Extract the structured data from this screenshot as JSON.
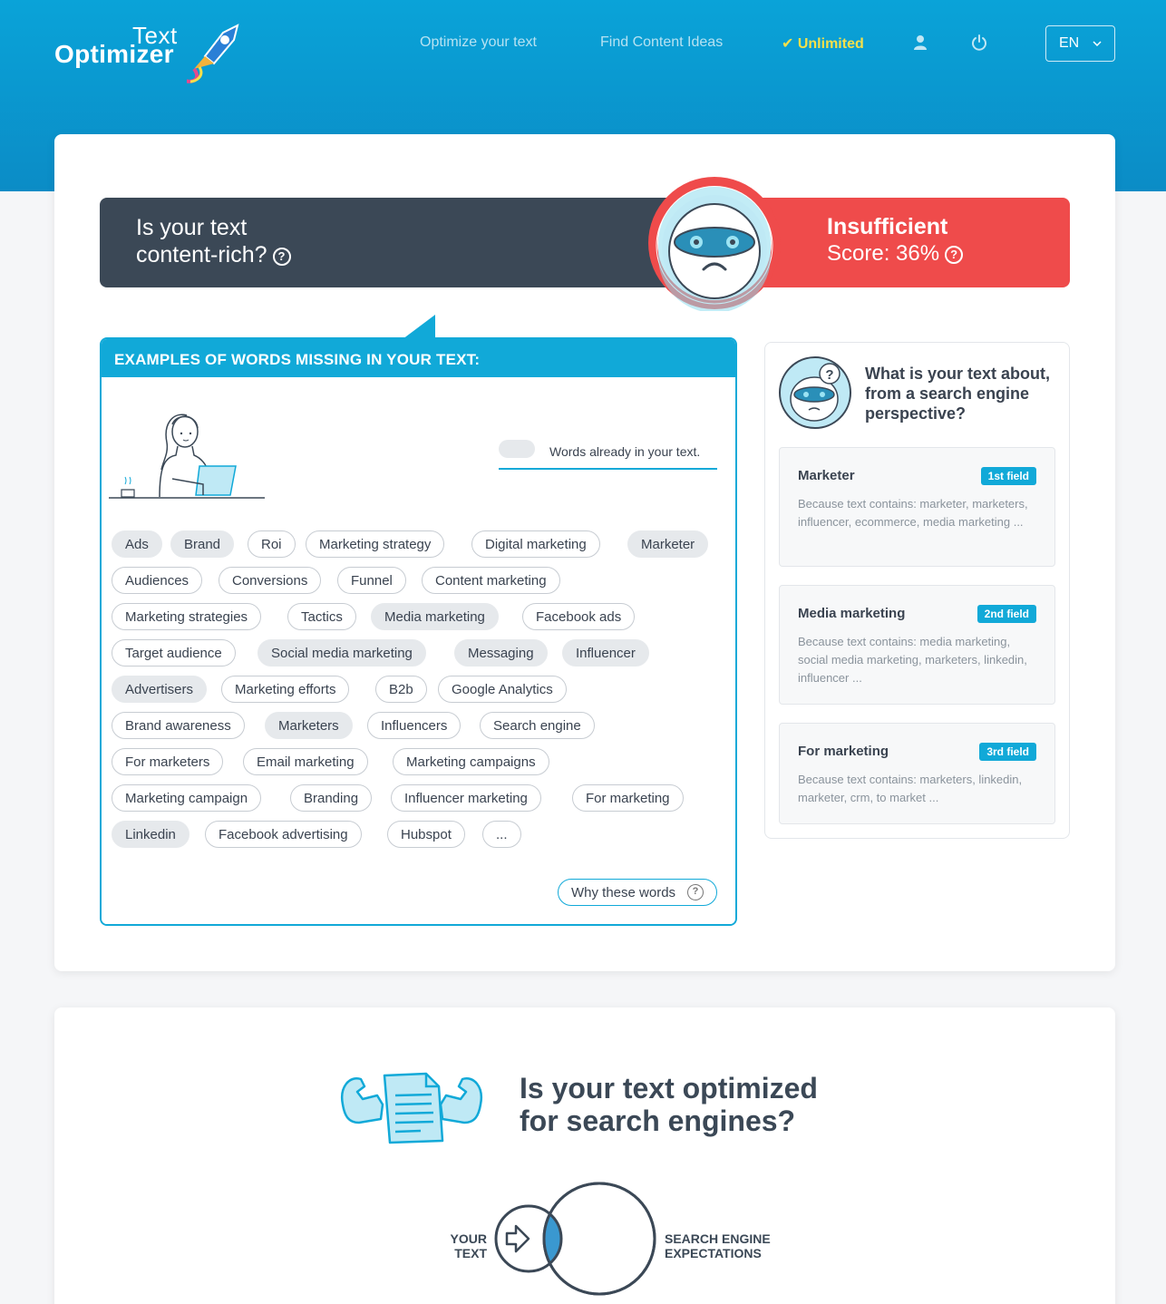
{
  "header": {
    "logo_text_top": "Text",
    "logo_text_main": "Optimizer",
    "nav": {
      "optimize": "Optimize your text",
      "find_ideas": "Find Content Ideas",
      "unlimited": "✔ Unlimited"
    },
    "language": "EN"
  },
  "score_banner": {
    "question_line1": "Is your text",
    "question_line2": "content-rich?",
    "status": "Insufficient",
    "score": "Score: 36%"
  },
  "missing_words": {
    "heading": "EXAMPLES OF WORDS MISSING IN YOUR TEXT:",
    "legend": "Words already in your text.",
    "chips": [
      {
        "label": "Ads",
        "have": true
      },
      {
        "label": "Brand",
        "have": true
      },
      {
        "label": "Roi",
        "have": false
      },
      {
        "label": "Marketing strategy",
        "have": false
      },
      {
        "label": "Digital marketing",
        "have": false
      },
      {
        "label": "Marketer",
        "have": true
      },
      {
        "label": "Audiences",
        "have": false
      },
      {
        "label": "Conversions",
        "have": false
      },
      {
        "label": "Funnel",
        "have": false
      },
      {
        "label": "Content marketing",
        "have": false
      },
      {
        "label": "Marketing strategies",
        "have": false
      },
      {
        "label": "Tactics",
        "have": false
      },
      {
        "label": "Media marketing",
        "have": true
      },
      {
        "label": "Facebook ads",
        "have": false
      },
      {
        "label": "Target audience",
        "have": false
      },
      {
        "label": "Social media marketing",
        "have": true
      },
      {
        "label": "Messaging",
        "have": true
      },
      {
        "label": "Influencer",
        "have": true
      },
      {
        "label": "Advertisers",
        "have": true
      },
      {
        "label": "Marketing efforts",
        "have": false
      },
      {
        "label": "B2b",
        "have": false
      },
      {
        "label": "Google Analytics",
        "have": false
      },
      {
        "label": "Brand awareness",
        "have": false
      },
      {
        "label": "Marketers",
        "have": true
      },
      {
        "label": "Influencers",
        "have": false
      },
      {
        "label": "Search engine",
        "have": false
      },
      {
        "label": "For marketers",
        "have": false
      },
      {
        "label": "Email marketing",
        "have": false
      },
      {
        "label": "Marketing campaigns",
        "have": false
      },
      {
        "label": "Marketing campaign",
        "have": false
      },
      {
        "label": "Branding",
        "have": false
      },
      {
        "label": "Influencer marketing",
        "have": false
      },
      {
        "label": "For marketing",
        "have": false
      },
      {
        "label": "Linkedin",
        "have": true
      },
      {
        "label": "Facebook advertising",
        "have": false
      },
      {
        "label": "Hubspot",
        "have": false
      },
      {
        "label": "...",
        "have": false
      }
    ],
    "why_button": "Why these words"
  },
  "search_engine": {
    "title": "What is your text about, from a search engine perspective?",
    "fields": [
      {
        "name": "Marketer",
        "tag": "1st field",
        "desc": "Because text contains:  marketer, marketers, influencer, ecommerce, media marketing ..."
      },
      {
        "name": "Media marketing",
        "tag": "2nd field",
        "desc": "Because text contains:  media marketing, social media marketing, marketers, linkedin, influencer ..."
      },
      {
        "name": "For marketing",
        "tag": "3rd field",
        "desc": "Because text contains:  marketers, linkedin, marketer, crm, to market ..."
      }
    ]
  },
  "optimized": {
    "title_line1": "Is your text optimized",
    "title_line2": "for search engines?",
    "venn_left_1": "YOUR",
    "venn_left_2": "TEXT",
    "venn_right_1": "SEARCH ENGINE",
    "venn_right_2": "EXPECTATIONS"
  },
  "colors": {
    "accent": "#11a9d8",
    "dark": "#3b4856",
    "danger": "#ef4b4b",
    "highlight": "#f5e04a"
  }
}
